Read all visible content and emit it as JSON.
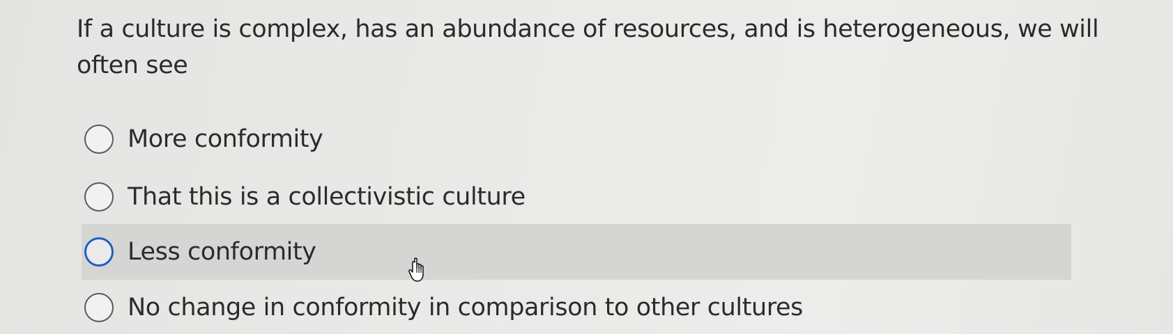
{
  "question": {
    "text": "If a culture is complex, has an abundance of resources, and is heterogeneous, we will often see"
  },
  "options": [
    {
      "label": "More conformity",
      "selected": false,
      "hovered": false
    },
    {
      "label": "That this is a collectivistic culture",
      "selected": false,
      "hovered": false
    },
    {
      "label": "Less conformity",
      "selected": false,
      "hovered": true
    },
    {
      "label": "No change in conformity in comparison to other cultures",
      "selected": false,
      "hovered": false
    }
  ],
  "colors": {
    "hover_background": "#d5d6d3",
    "focus_ring": "#1f5fc7",
    "text": "#2b2b2b"
  },
  "cursor": {
    "icon": "hand-pointer-icon"
  }
}
